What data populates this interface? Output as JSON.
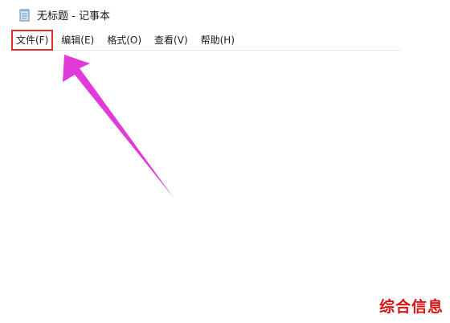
{
  "window": {
    "title": "无标题 - 记事本",
    "icon": "notepad-icon"
  },
  "menubar": {
    "items": [
      {
        "label": "文件(F)",
        "highlighted": true
      },
      {
        "label": "编辑(E)",
        "highlighted": false
      },
      {
        "label": "格式(O)",
        "highlighted": false
      },
      {
        "label": "查看(V)",
        "highlighted": false
      },
      {
        "label": "帮助(H)",
        "highlighted": false
      }
    ]
  },
  "annotation": {
    "highlight_color": "#e32b2b",
    "arrow_color": "#e03ad8",
    "arrow_target": "文件(F)"
  },
  "watermark": {
    "text": "综合信息",
    "color": "#d61414"
  }
}
